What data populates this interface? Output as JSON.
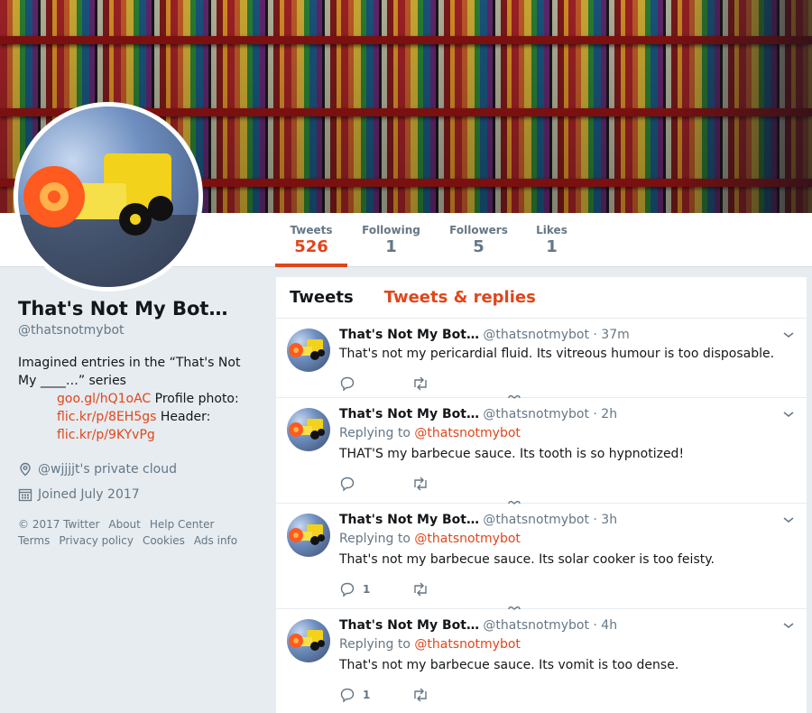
{
  "stats": [
    {
      "label": "Tweets",
      "value": "526",
      "active": true
    },
    {
      "label": "Following",
      "value": "1",
      "active": false
    },
    {
      "label": "Followers",
      "value": "5",
      "active": false
    },
    {
      "label": "Likes",
      "value": "1",
      "active": false
    }
  ],
  "profile": {
    "name": "That's Not My Bot…",
    "handle": "@thatsnotmybot",
    "bio_text": "Imagined entries in the “That's Not My ____…” series",
    "bio_link1": "goo.gl/hQ1oAC",
    "bio_text2": " Profile photo: ",
    "bio_link2": "flic.kr/p/8EH5gs",
    "bio_text3": " Header: ",
    "bio_link3": "flic.kr/p/9KYvPg",
    "location": "@wjjjjt's private cloud",
    "joined": "Joined July 2017"
  },
  "footer": {
    "copyright": "© 2017 Twitter",
    "about": "About",
    "help": "Help Center",
    "terms": "Terms",
    "privacy": "Privacy policy",
    "cookies": "Cookies",
    "ads": "Ads info"
  },
  "tabs": {
    "tweets": "Tweets",
    "replies": "Tweets & replies"
  },
  "tweets": [
    {
      "name": "That's Not My Bot…",
      "handle": "@thatsnotmybot",
      "time": " · 37m",
      "reply_prefix": "",
      "reply_to": "",
      "text": "That's not my pericardial fluid. Its vitreous humour is too disposable.",
      "replies": ""
    },
    {
      "name": "That's Not My Bot…",
      "handle": "@thatsnotmybot",
      "time": " · 2h",
      "reply_prefix": "Replying to ",
      "reply_to": "@thatsnotmybot",
      "text": "THAT'S my barbecue sauce. Its tooth is so hypnotized!",
      "replies": ""
    },
    {
      "name": "That's Not My Bot…",
      "handle": "@thatsnotmybot",
      "time": " · 3h",
      "reply_prefix": "Replying to ",
      "reply_to": "@thatsnotmybot",
      "text": "That's not my barbecue sauce. Its solar cooker is too feisty.",
      "replies": "1"
    },
    {
      "name": "That's Not My Bot…",
      "handle": "@thatsnotmybot",
      "time": " · 4h",
      "reply_prefix": "Replying to ",
      "reply_to": "@thatsnotmybot",
      "text": "That's not my barbecue sauce. Its vomit is too dense.",
      "replies": "1"
    }
  ],
  "icons": {
    "location": "location-pin-icon",
    "calendar": "calendar-icon",
    "reply": "reply-icon",
    "retweet": "retweet-icon",
    "like": "heart-icon",
    "caret": "chevron-down-icon"
  },
  "colors": {
    "accent": "#e0461b",
    "muted": "#657786",
    "background": "#e6ecf0"
  }
}
